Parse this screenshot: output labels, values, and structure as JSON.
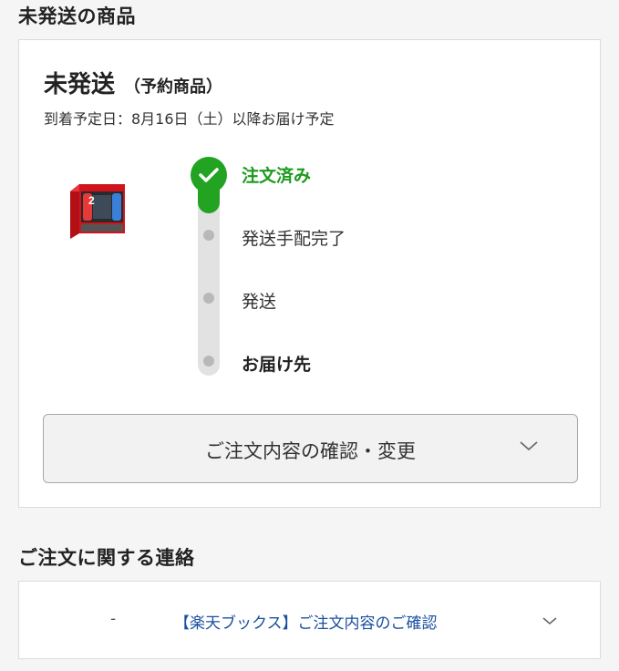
{
  "sections": {
    "unshipped_title": "未発送の商品",
    "contact_title": "ご注文に関する連絡"
  },
  "status": {
    "main": "未発送",
    "sub": "（予約商品）",
    "arrival": "到着予定日：8月16日（土）以降お届け予定"
  },
  "product": {
    "image": "console-box-icon",
    "box_label": "2"
  },
  "timeline": {
    "progress": 0.25,
    "steps": [
      {
        "label": "注文済み",
        "done": true
      },
      {
        "label": "発送手配完了",
        "done": false
      },
      {
        "label": "発送",
        "done": false
      },
      {
        "label": "お届け先",
        "done": false
      }
    ]
  },
  "confirm_button": {
    "label": "ご注文内容の確認・変更",
    "icon": "chevron-down-icon"
  },
  "contact": {
    "dash": "-",
    "link": "【楽天ブックス】ご注文内容のご確認",
    "icon": "chevron-down-icon"
  },
  "colors": {
    "accent_green": "#22a322",
    "link_blue": "#1a4fa0",
    "box_red": "#d0141c"
  }
}
